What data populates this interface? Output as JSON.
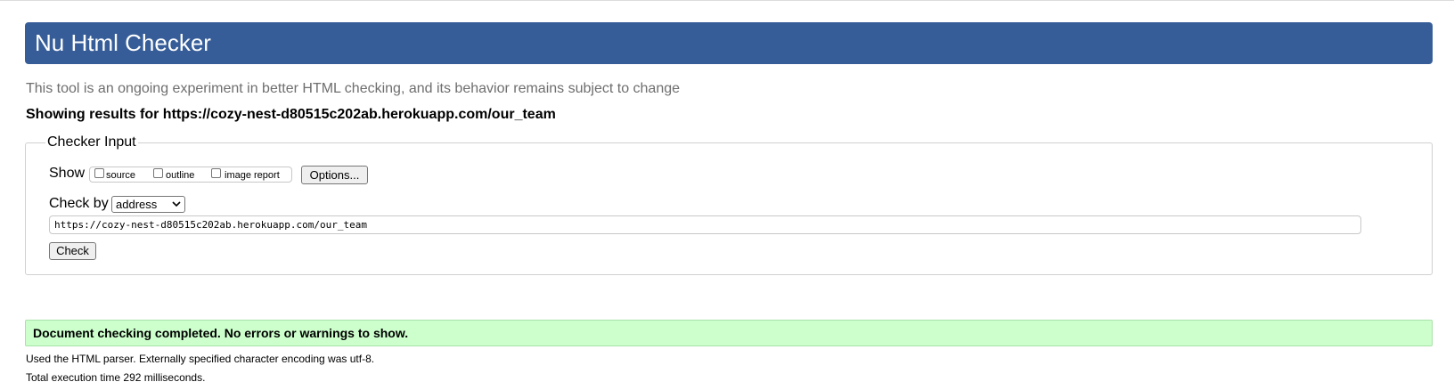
{
  "header": {
    "title": "Nu Html Checker",
    "color": "#365d98"
  },
  "tagline": "This tool is an ongoing experiment in better HTML checking, and its behavior remains subject to change",
  "results_for": "Showing results for https://cozy-nest-d80515c202ab.herokuapp.com/our_team",
  "checker_input": {
    "legend": "Checker Input",
    "show_label": "Show",
    "show_options": [
      {
        "label": "source",
        "checked": false
      },
      {
        "label": "outline",
        "checked": false
      },
      {
        "label": "image report",
        "checked": false
      }
    ],
    "options_button": "Options...",
    "check_by_label": "Check by",
    "check_by_value": "address",
    "url_value": "https://cozy-nest-d80515c202ab.herokuapp.com/our_team",
    "check_button": "Check"
  },
  "result": {
    "message": "Document checking completed. No errors or warnings to show.",
    "color": "#ccffcc"
  },
  "info": {
    "parser": "Used the HTML parser. Externally specified character encoding was utf-8.",
    "execution_time": "Total execution time 292 milliseconds."
  }
}
